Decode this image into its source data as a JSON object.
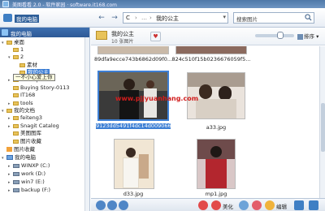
{
  "window": {
    "title": "美图看看 2.0 - 软件家园 · software.it168.com"
  },
  "toolbar": {
    "home_label": "我的电脑",
    "back": "←",
    "forward": "→",
    "address": {
      "segment1": "C",
      "segment2": "我的公主"
    },
    "search_placeholder": "搜索图片"
  },
  "sidebar": {
    "header": "我的电脑",
    "items": [
      {
        "label": "桌面",
        "type": "folder",
        "exp": "▾"
      },
      {
        "label": "1",
        "type": "folder",
        "exp": ""
      },
      {
        "label": "2",
        "type": "folder",
        "exp": "▾"
      },
      {
        "label": "素材",
        "type": "folder",
        "exp": ""
      },
      {
        "label": "我的公主",
        "type": "folder",
        "exp": "",
        "selected": true
      },
      {
        "label": "backup",
        "type": "folder",
        "exp": "▸"
      },
      {
        "label": "Buying Story-0113",
        "type": "folder",
        "exp": ""
      },
      {
        "label": "IT168",
        "type": "folder",
        "exp": ""
      },
      {
        "label": "tools",
        "type": "folder",
        "exp": "▸"
      },
      {
        "label": "我的文档",
        "type": "folder",
        "exp": "▾"
      },
      {
        "label": "feiteng3",
        "type": "folder",
        "exp": "▸"
      },
      {
        "label": "Snagit Catalog",
        "type": "folder",
        "exp": "▸"
      },
      {
        "label": "美图图库",
        "type": "folder",
        "exp": ""
      },
      {
        "label": "图片收藏",
        "type": "folder",
        "exp": ""
      },
      {
        "label": "图片收藏",
        "type": "fav",
        "exp": ""
      },
      {
        "label": "我的电脑",
        "type": "pc",
        "exp": "▾"
      },
      {
        "label": "WINXP (C:)",
        "type": "drive",
        "exp": "▸"
      },
      {
        "label": "work (D:)",
        "type": "drive",
        "exp": "▸"
      },
      {
        "label": "win7 (E:)",
        "type": "drive",
        "exp": "▸"
      },
      {
        "label": "backup (F:)",
        "type": "drive",
        "exp": "▸"
      }
    ],
    "tooltip": "一不小心爱上你"
  },
  "folder": {
    "title": "我的公主",
    "count": "10 张图片"
  },
  "sort_label": "排序",
  "images": [
    {
      "caption": "89dfa9ecce743b6862d09f0...",
      "selected": false
    },
    {
      "caption": "824c510f15b0236676059f5...",
      "selected": false
    },
    {
      "caption": "9123dd5491f4dc14d00906683.jpg",
      "selected": true
    },
    {
      "caption": "a33.jpg",
      "selected": false
    },
    {
      "caption": "d33.jpg",
      "selected": false
    },
    {
      "caption": "mp1.jpg",
      "selected": false
    }
  ],
  "watermark": "www.pjjyuanhang.com",
  "bottom": {
    "beautify": "美化",
    "edit": "编辑"
  },
  "colors": {
    "accent": "#3d7fd4",
    "titlebar": "#4f79a8"
  }
}
